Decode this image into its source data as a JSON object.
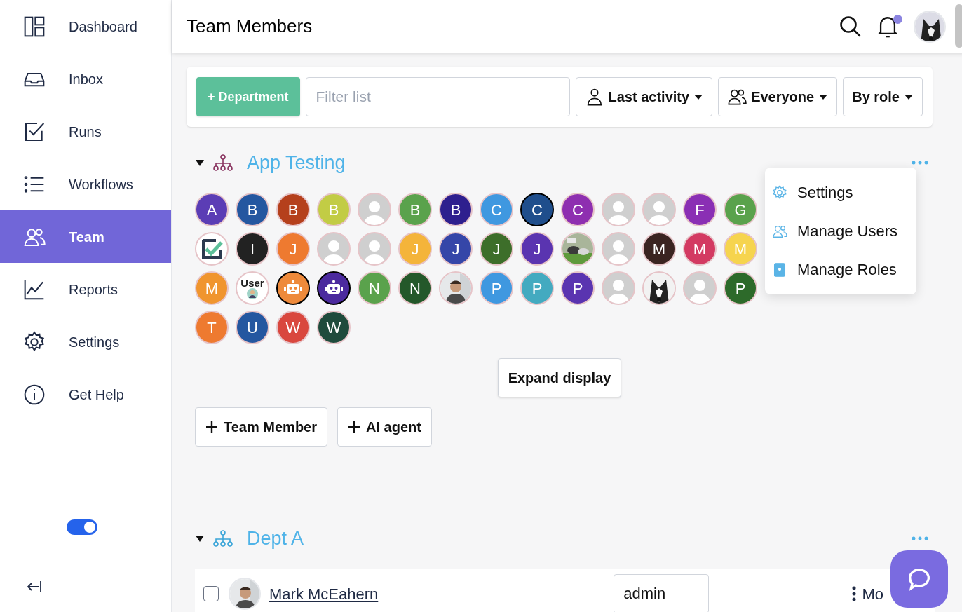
{
  "sidebar": {
    "items": [
      {
        "label": "Dashboard",
        "selected": false
      },
      {
        "label": "Inbox",
        "selected": false
      },
      {
        "label": "Runs",
        "selected": false
      },
      {
        "label": "Workflows",
        "selected": false
      },
      {
        "label": "Team",
        "selected": true
      },
      {
        "label": "Reports",
        "selected": false
      },
      {
        "label": "Settings",
        "selected": false
      },
      {
        "label": "Get Help",
        "selected": false
      }
    ],
    "toggle": {
      "on": true
    }
  },
  "header": {
    "title": "Team Members",
    "notification_dot": true
  },
  "toolbar": {
    "add_button": "+ Department",
    "filter": {
      "placeholder": "Filter list"
    },
    "dropdowns": [
      {
        "label": "Last activity"
      },
      {
        "label": "Everyone"
      },
      {
        "label": "By role"
      }
    ]
  },
  "sections": [
    {
      "title": "App Testing",
      "expanded": true,
      "avatars": [
        {
          "kind": "letter",
          "letter": "A",
          "color": "#5b3db5",
          "outlined": false
        },
        {
          "kind": "letter",
          "letter": "B",
          "color": "#2457a0",
          "outlined": false
        },
        {
          "kind": "letter",
          "letter": "B",
          "color": "#b5401c",
          "outlined": false
        },
        {
          "kind": "letter",
          "letter": "B",
          "color": "#c2cc45",
          "outlined": false
        },
        {
          "kind": "placeholder",
          "outlined": false
        },
        {
          "kind": "letter",
          "letter": "B",
          "color": "#5aa24c",
          "outlined": false
        },
        {
          "kind": "letter",
          "letter": "B",
          "color": "#2e1f8e",
          "outlined": false
        },
        {
          "kind": "letter",
          "letter": "C",
          "color": "#3f98e0",
          "outlined": false
        },
        {
          "kind": "letter",
          "letter": "C",
          "color": "#1f4e8c",
          "outlined": true
        },
        {
          "kind": "letter",
          "letter": "C",
          "color": "#8e2fb0",
          "outlined": false
        },
        {
          "kind": "placeholder",
          "outlined": false
        },
        {
          "kind": "placeholder",
          "outlined": false
        },
        {
          "kind": "letter",
          "letter": "F",
          "color": "#8a2fb4",
          "outlined": false
        },
        {
          "kind": "letter",
          "letter": "G",
          "color": "#5aa24c",
          "outlined": false
        },
        {
          "kind": "logo",
          "outlined": false
        },
        {
          "kind": "letter",
          "letter": "I",
          "color": "#222222",
          "outlined": false
        },
        {
          "kind": "letter",
          "letter": "J",
          "color": "#ee7a30",
          "outlined": false
        },
        {
          "kind": "placeholder",
          "outlined": false
        },
        {
          "kind": "placeholder",
          "outlined": false
        },
        {
          "kind": "letter",
          "letter": "J",
          "color": "#f4b43a",
          "outlined": false
        },
        {
          "kind": "letter",
          "letter": "J",
          "color": "#3546a8",
          "outlined": false
        },
        {
          "kind": "letter",
          "letter": "J",
          "color": "#3d6e2a",
          "outlined": false
        },
        {
          "kind": "letter",
          "letter": "J",
          "color": "#5a34b0",
          "outlined": false
        },
        {
          "kind": "picture",
          "outlined": false
        },
        {
          "kind": "placeholder",
          "outlined": false
        },
        {
          "kind": "letter",
          "letter": "M",
          "color": "#3a2421",
          "outlined": false
        },
        {
          "kind": "letter",
          "letter": "M",
          "color": "#d33a62",
          "outlined": false
        },
        {
          "kind": "letter",
          "letter": "M",
          "color": "#f6d44e",
          "outlined": false
        },
        {
          "kind": "letter",
          "letter": "M",
          "color": "#f0952e",
          "outlined": false
        },
        {
          "kind": "user_label",
          "letter": "User",
          "outlined": false
        },
        {
          "kind": "robot",
          "color": "#ee8a3b",
          "outlined": true
        },
        {
          "kind": "robot",
          "color": "#4b2a9e",
          "outlined": true
        },
        {
          "kind": "letter",
          "letter": "N",
          "color": "#5aa24c",
          "outlined": false
        },
        {
          "kind": "letter",
          "letter": "N",
          "color": "#24582a",
          "outlined": false
        },
        {
          "kind": "picture",
          "outlined": false
        },
        {
          "kind": "letter",
          "letter": "P",
          "color": "#3f98e0",
          "outlined": false
        },
        {
          "kind": "letter",
          "letter": "P",
          "color": "#43aac0",
          "outlined": false
        },
        {
          "kind": "letter",
          "letter": "P",
          "color": "#5a34b0",
          "outlined": false
        },
        {
          "kind": "placeholder",
          "outlined": false
        },
        {
          "kind": "picture",
          "outlined": false
        },
        {
          "kind": "placeholder",
          "outlined": false
        },
        {
          "kind": "letter",
          "letter": "P",
          "color": "#2d6a2a",
          "outlined": false
        },
        {
          "kind": "letter",
          "letter": "T",
          "color": "#ee7a30",
          "outlined": false
        },
        {
          "kind": "letter",
          "letter": "U",
          "color": "#2457a0",
          "outlined": false
        },
        {
          "kind": "letter",
          "letter": "W",
          "color": "#d9473e",
          "outlined": false
        },
        {
          "kind": "letter",
          "letter": "W",
          "color": "#1f4b3c",
          "outlined": false
        }
      ],
      "expand_button": "Expand display",
      "add_buttons": [
        "Team Member",
        "AI agent"
      ],
      "menu": [
        {
          "label": "Settings"
        },
        {
          "label": "Manage Users"
        },
        {
          "label": "Manage Roles"
        }
      ]
    },
    {
      "title": "Dept A",
      "expanded": true,
      "rows": [
        {
          "checked": false,
          "name": "Mark McEahern",
          "role": "admin",
          "action": "Mo"
        }
      ]
    }
  ]
}
